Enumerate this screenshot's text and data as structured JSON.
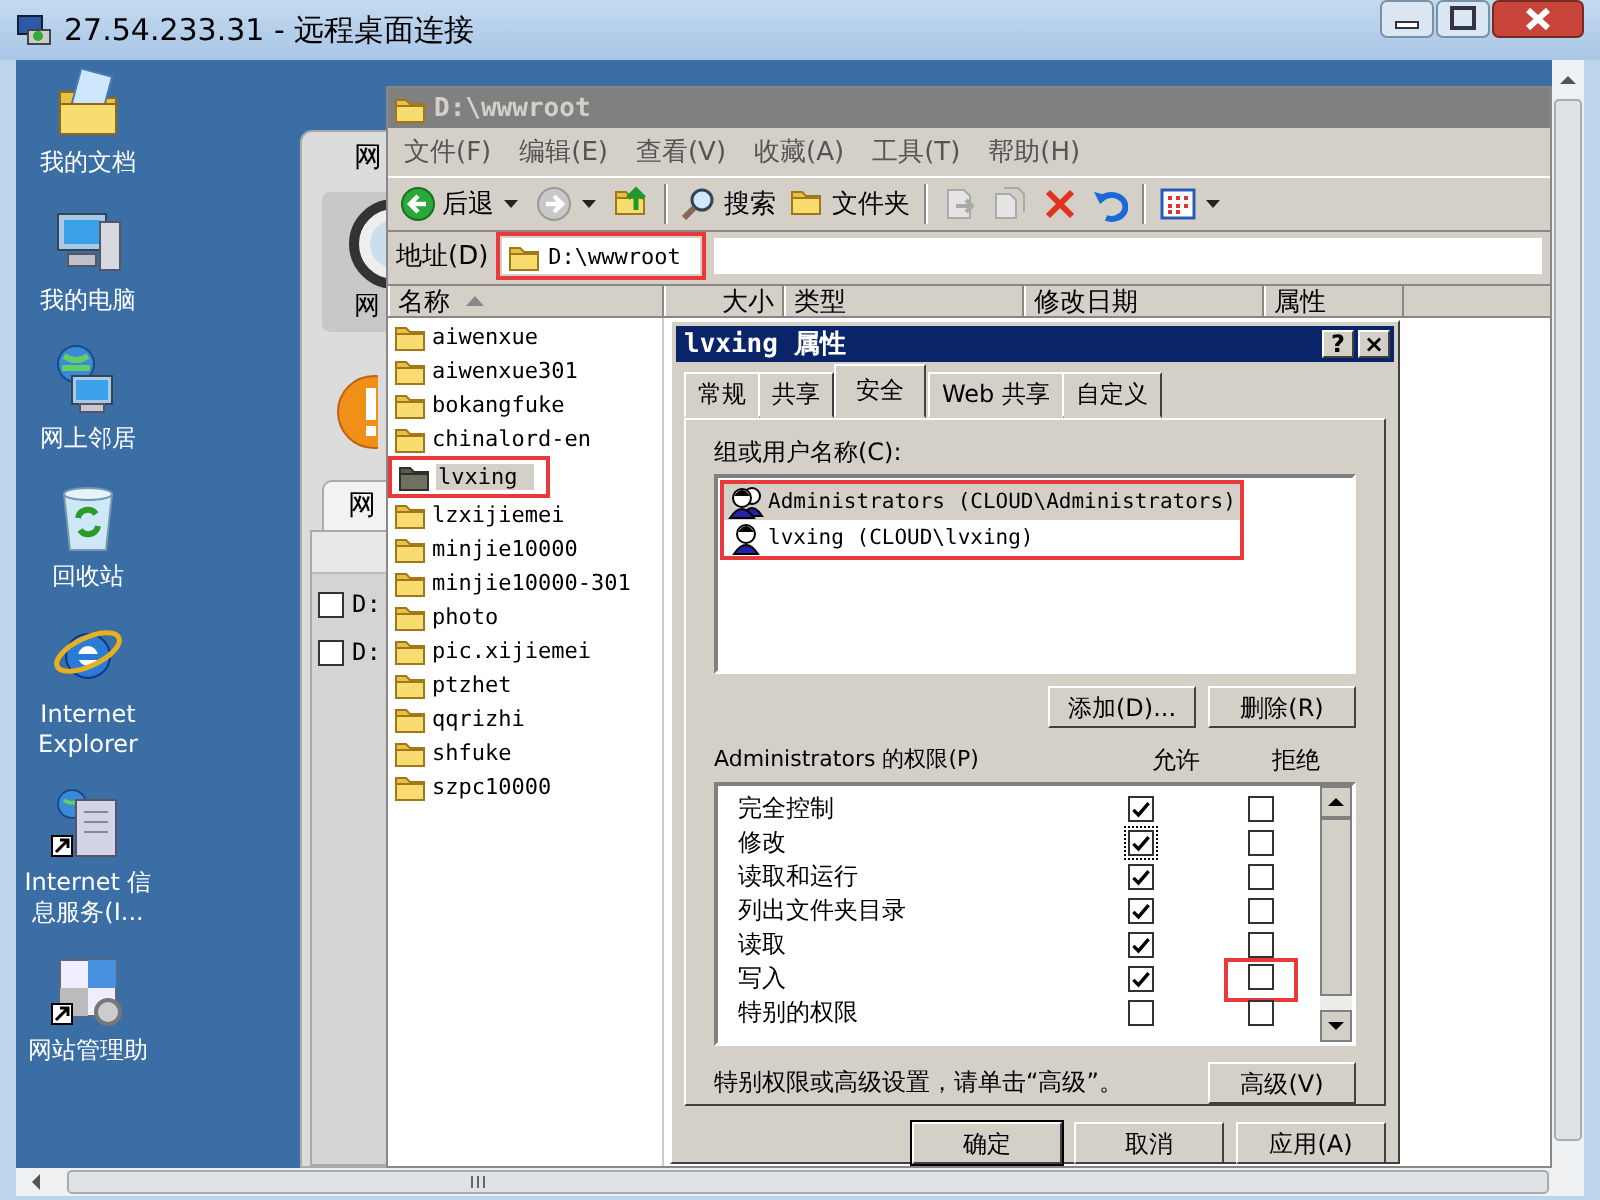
{
  "window": {
    "title": "27.54.233.31 - 远程桌面连接"
  },
  "desktop_icons": [
    {
      "label": "我的文档",
      "kind": "documents"
    },
    {
      "label": "我的电脑",
      "kind": "computer"
    },
    {
      "label": "网上邻居",
      "kind": "network"
    },
    {
      "label": "回收站",
      "kind": "recycle"
    },
    {
      "label": "Internet Explorer",
      "kind": "browser"
    },
    {
      "label": "Internet 信息服务(I...",
      "kind": "server"
    },
    {
      "label": "网站管理助",
      "kind": "tool"
    }
  ],
  "background_window": {
    "heading": "网",
    "icon_label": "网",
    "tab": "网",
    "rows": [
      {
        "text": "D:",
        "checked": false
      },
      {
        "text": "D:",
        "checked": false
      }
    ]
  },
  "explorer": {
    "title": "D:\\wwwroot",
    "menu": [
      "文件(F)",
      "编辑(E)",
      "查看(V)",
      "收藏(A)",
      "工具(T)",
      "帮助(H)"
    ],
    "toolbar": [
      {
        "kind": "back",
        "label": "后退"
      },
      {
        "kind": "forward"
      },
      {
        "kind": "up"
      },
      {
        "kind": "search",
        "label": "搜索"
      },
      {
        "kind": "folders",
        "label": "文件夹"
      },
      {
        "kind": "move"
      },
      {
        "kind": "copy"
      },
      {
        "kind": "delete"
      },
      {
        "kind": "undo"
      },
      {
        "kind": "views"
      }
    ],
    "address": {
      "label": "地址(D)",
      "value": "D:\\wwwroot",
      "highlighted": true
    },
    "columns": [
      "名称",
      "大小",
      "类型",
      "修改日期",
      "属性"
    ],
    "files": [
      {
        "name": "aiwenxue",
        "selected": false,
        "highlighted": false
      },
      {
        "name": "aiwenxue301",
        "selected": false,
        "highlighted": false
      },
      {
        "name": "bokangfuke",
        "selected": false,
        "highlighted": false
      },
      {
        "name": "chinalord-en",
        "selected": false,
        "highlighted": false
      },
      {
        "name": "lvxing",
        "selected": true,
        "highlighted": true
      },
      {
        "name": "lzxijiemei",
        "selected": false,
        "highlighted": false
      },
      {
        "name": "minjie10000",
        "selected": false,
        "highlighted": false
      },
      {
        "name": "minjie10000-301",
        "selected": false,
        "highlighted": false
      },
      {
        "name": "photo",
        "selected": false,
        "highlighted": false
      },
      {
        "name": "pic.xijiemei",
        "selected": false,
        "highlighted": false
      },
      {
        "name": "ptzhet",
        "selected": false,
        "highlighted": false
      },
      {
        "name": "qqrizhi",
        "selected": false,
        "highlighted": false
      },
      {
        "name": "shfuke",
        "selected": false,
        "highlighted": false
      },
      {
        "name": "szpc10000",
        "selected": false,
        "highlighted": false
      }
    ]
  },
  "dialog": {
    "title": "lvxing 属性",
    "help_button": "?",
    "close_button": "×",
    "tabs": [
      {
        "label": "常规",
        "selected": false
      },
      {
        "label": "共享",
        "selected": false
      },
      {
        "label": "安全",
        "selected": true
      },
      {
        "label": "Web 共享",
        "selected": false
      },
      {
        "label": "自定义",
        "selected": false
      }
    ],
    "users_label": "组或用户名称(C):",
    "users": {
      "highlighted": true,
      "items": [
        {
          "name": "Administrators (CLOUD\\Administrators)",
          "kind": "group",
          "selected": true
        },
        {
          "name": "lvxing (CLOUD\\lvxing)",
          "kind": "user",
          "selected": false
        }
      ]
    },
    "user_buttons": [
      "添加(D)...",
      "删除(R)"
    ],
    "permissions": {
      "label": "Administrators 的权限(P)",
      "allow_header": "允许",
      "deny_header": "拒绝",
      "rows": [
        {
          "name": "完全控制",
          "allow": true,
          "deny": false,
          "focused": false,
          "deny_highlighted": false
        },
        {
          "name": "修改",
          "allow": true,
          "deny": false,
          "focused": true,
          "deny_highlighted": false
        },
        {
          "name": "读取和运行",
          "allow": true,
          "deny": false,
          "focused": false,
          "deny_highlighted": false
        },
        {
          "name": "列出文件夹目录",
          "allow": true,
          "deny": false,
          "focused": false,
          "deny_highlighted": false
        },
        {
          "name": "读取",
          "allow": true,
          "deny": false,
          "focused": false,
          "deny_highlighted": false
        },
        {
          "name": "写入",
          "allow": true,
          "deny": false,
          "focused": false,
          "deny_highlighted": true
        },
        {
          "name": "特别的权限",
          "allow": false,
          "deny": false,
          "focused": false,
          "deny_highlighted": false
        }
      ]
    },
    "note": "特别权限或高级设置，请单击“高级”。",
    "advanced_button": "高级(V)",
    "footer_buttons": [
      "确定",
      "取消",
      "应用(A)"
    ]
  }
}
